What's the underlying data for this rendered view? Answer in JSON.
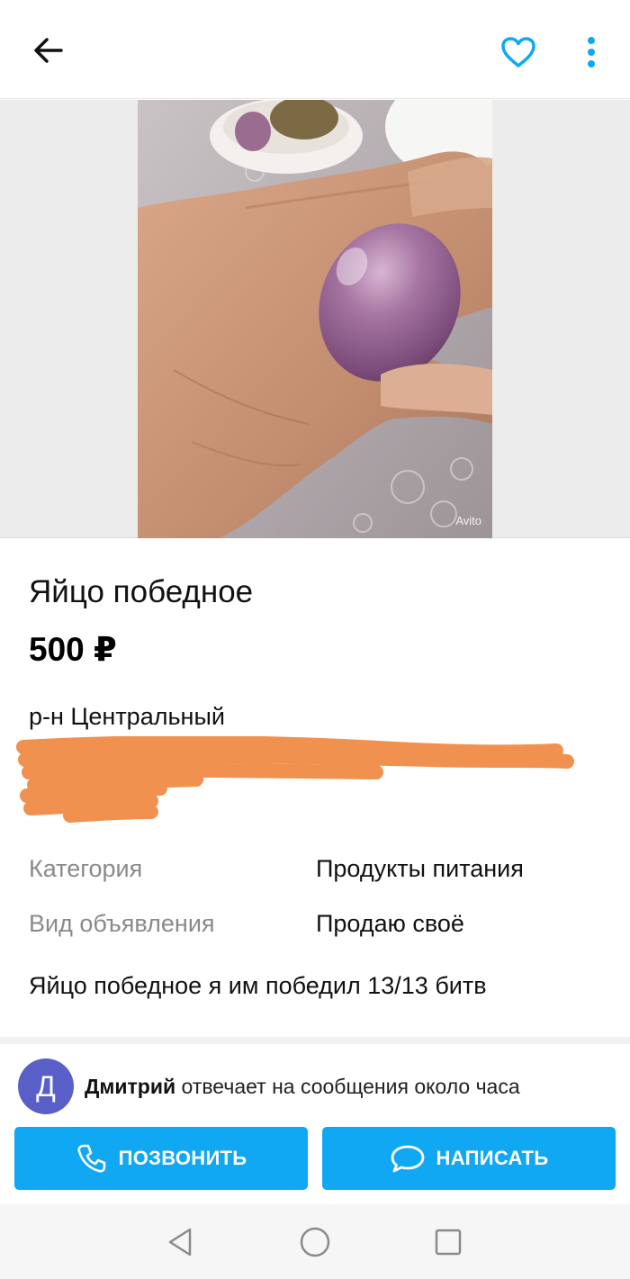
{
  "header": {
    "back_icon": "arrow-left-icon",
    "favorite_icon": "heart-icon",
    "more_icon": "more-vertical-icon",
    "accent_color": "#10a8f2"
  },
  "gallery": {
    "watermark": "Avito"
  },
  "listing": {
    "title": "Яйцо победное",
    "price": "500 ₽",
    "location": "р-н Центральный",
    "params": [
      {
        "label": "Категория",
        "value": "Продукты питания"
      },
      {
        "label": "Вид объявления",
        "value": "Продаю своё"
      }
    ],
    "description": "Яйцо победное я им победил 13/13 битв"
  },
  "seller": {
    "avatar_letter": "Д",
    "avatar_color": "#5a5fc8",
    "name": "Дмитрий",
    "response_text": "отвечает на сообщения около часа"
  },
  "actions": {
    "call_label": "ПОЗВОНИТЬ",
    "message_label": "НАПИСАТЬ",
    "button_color": "#10a8f2"
  },
  "system_nav": {
    "back_icon": "triangle-back-icon",
    "home_icon": "circle-home-icon",
    "recents_icon": "square-recents-icon"
  }
}
